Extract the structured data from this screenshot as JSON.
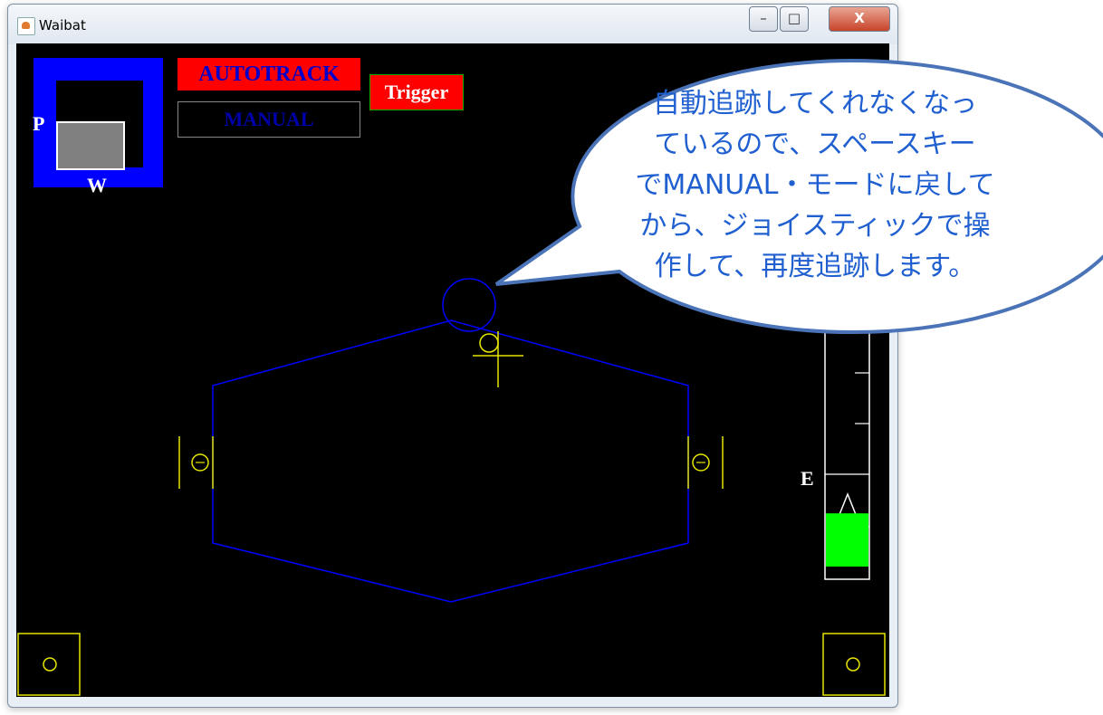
{
  "window": {
    "title": "Waibat",
    "buttons": {
      "minimize": "–",
      "maximize": "□",
      "close": "X"
    }
  },
  "hud": {
    "autotrack_label": "AUTOTRACK",
    "manual_label": "MANUAL",
    "trigger_label": "Trigger",
    "pan_label": "P",
    "width_label": "W",
    "elevation_label": "E"
  },
  "callout": {
    "lines": [
      "自動追跡してくれなくなっ",
      "ているので、スペースキー",
      "でMANUAL・モードに戻して",
      "から、ジョイスティックで操",
      "作して、再度追跡します。"
    ]
  },
  "colors": {
    "frame_blue": "#0000ff",
    "crosshair_yellow": "#e6e600",
    "gauge_green": "#00ff00",
    "label_red": "#ff0000",
    "bubble_fill": "#ffffff",
    "bubble_border": "#4a73b8",
    "bubble_text": "#1f5fd0"
  },
  "gauge": {
    "level_fraction": 0.15
  }
}
